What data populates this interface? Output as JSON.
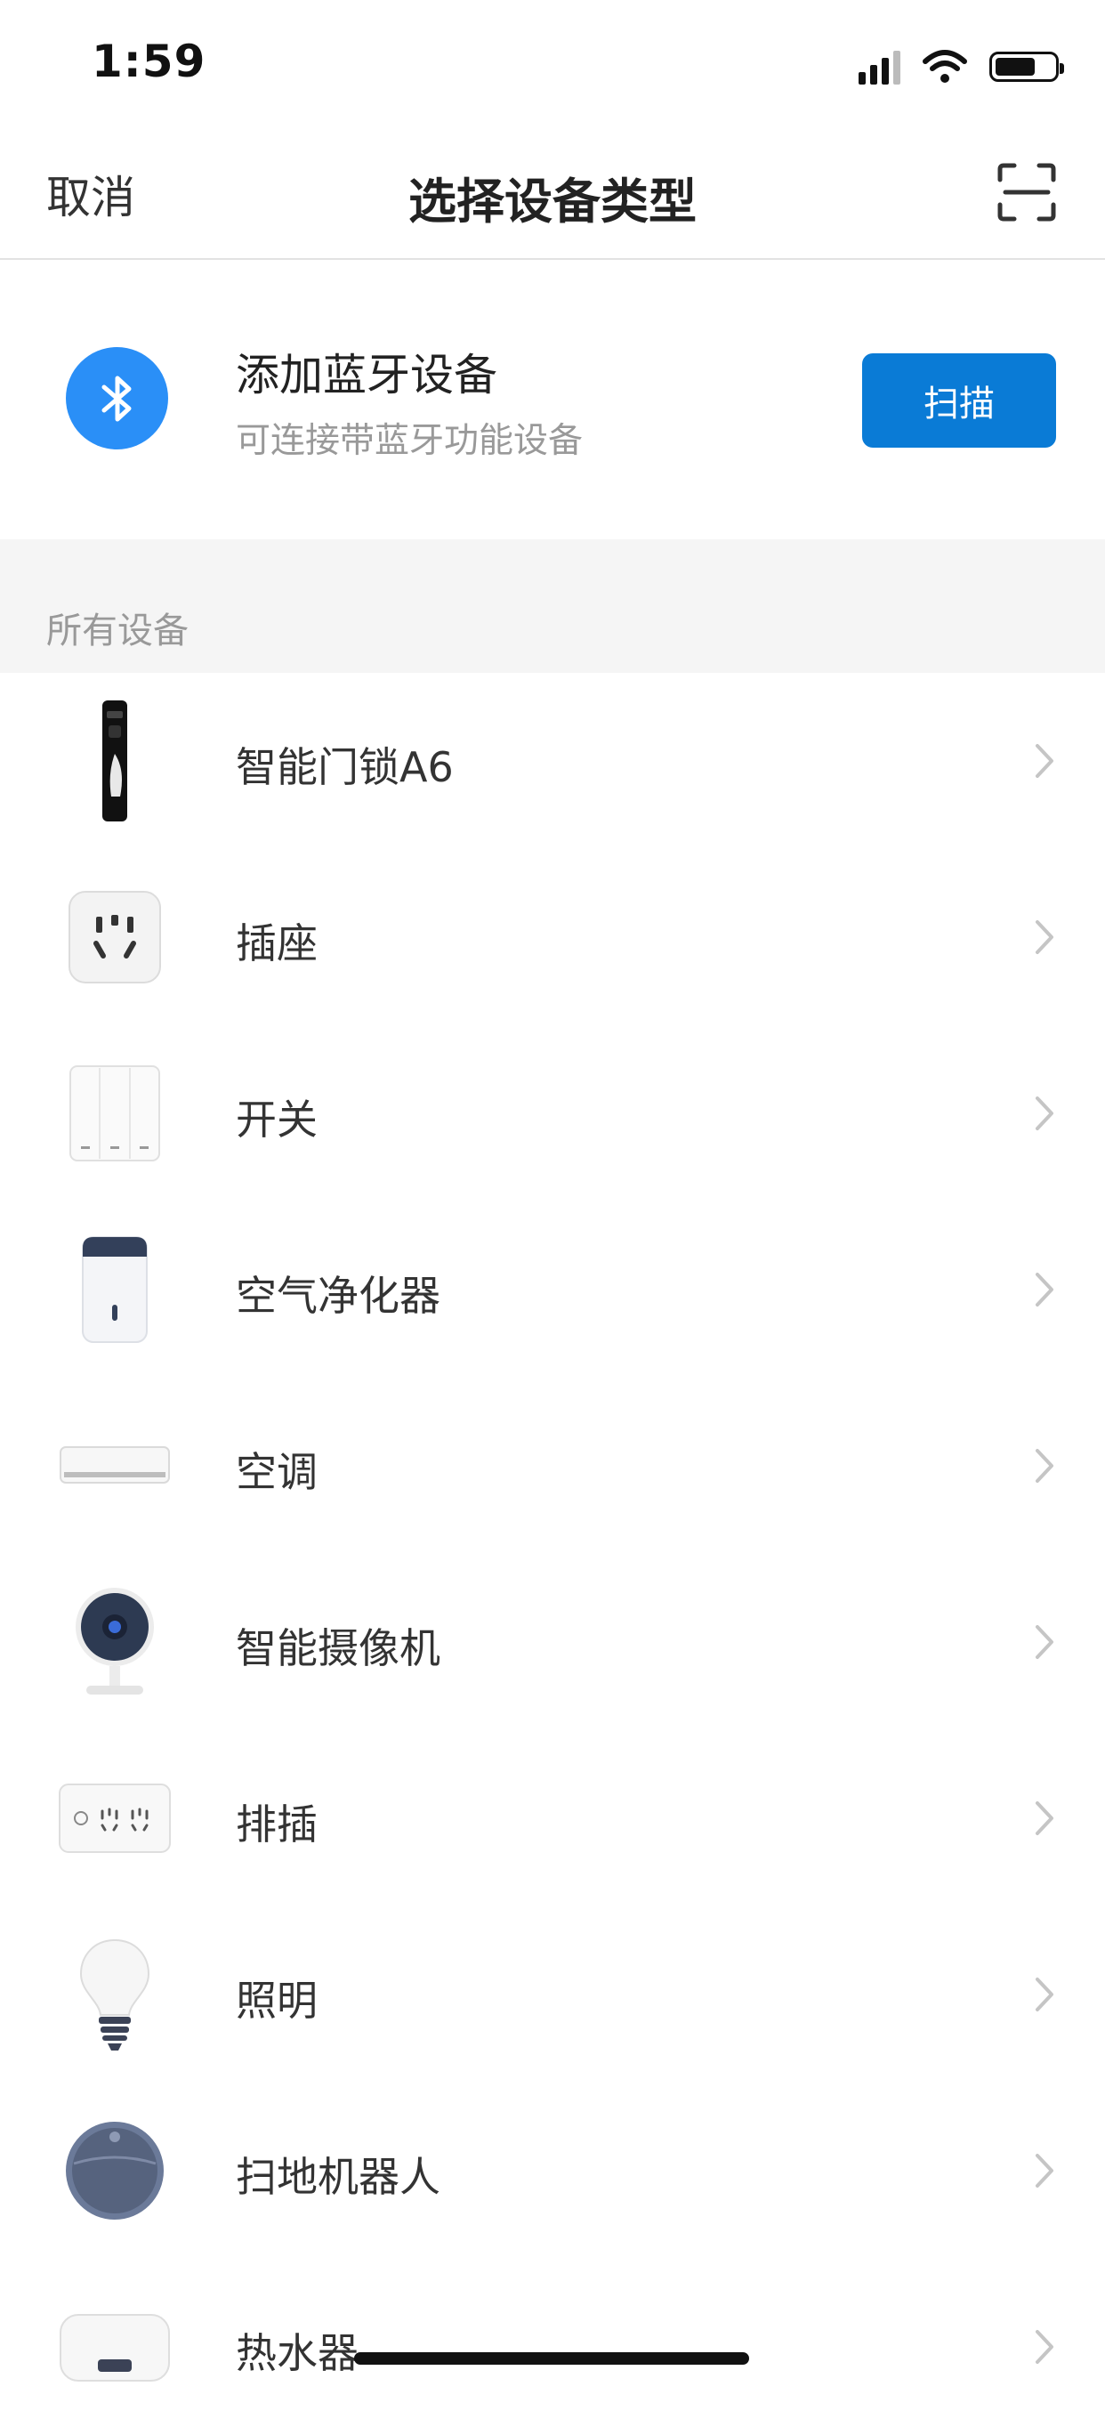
{
  "status_bar": {
    "time": "1:59"
  },
  "nav": {
    "cancel_label": "取消",
    "title": "选择设备类型",
    "scan_icon": "scan-frame-icon"
  },
  "bluetooth": {
    "title": "添加蓝牙设备",
    "subtitle": "可连接带蓝牙功能设备",
    "button_label": "扫描",
    "icon": "bluetooth-icon",
    "accent": "#2a8ff7",
    "button_color": "#0a7bd6"
  },
  "section": {
    "title": "所有设备"
  },
  "devices": [
    {
      "name": "智能门锁A6",
      "icon": "door-lock-icon"
    },
    {
      "name": "插座",
      "icon": "socket-icon"
    },
    {
      "name": "开关",
      "icon": "switch-icon"
    },
    {
      "name": "空气净化器",
      "icon": "air-purifier-icon"
    },
    {
      "name": "空调",
      "icon": "air-conditioner-icon"
    },
    {
      "name": "智能摄像机",
      "icon": "camera-icon"
    },
    {
      "name": "排插",
      "icon": "power-strip-icon"
    },
    {
      "name": "照明",
      "icon": "bulb-icon"
    },
    {
      "name": "扫地机器人",
      "icon": "robot-vacuum-icon"
    },
    {
      "name": "热水器",
      "icon": "water-heater-icon"
    }
  ]
}
